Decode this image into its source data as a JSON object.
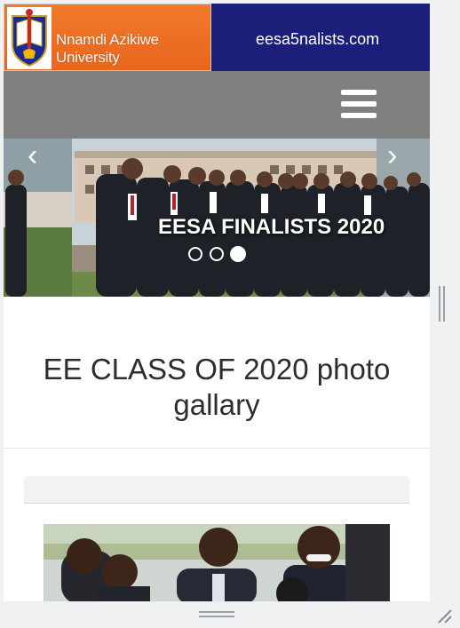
{
  "header": {
    "university_name": "Nnamdi Azikiwe University",
    "site_url": "eesa5nalists.com",
    "logo_icon": "university-crest-icon"
  },
  "nav": {
    "menu_icon": "hamburger-menu-icon"
  },
  "slider": {
    "caption": "EESA FINALISTS 2020",
    "prev_glyph": "‹",
    "next_glyph": "›",
    "active_slide": 3,
    "slide_count": 3
  },
  "main": {
    "title": "EE CLASS OF 2020 photo gallary"
  },
  "colors": {
    "header_bg": "#1b1f7a",
    "logo_bg": "#e8661e",
    "nav_bg": "#808080",
    "title_text": "#2d2d2d"
  }
}
